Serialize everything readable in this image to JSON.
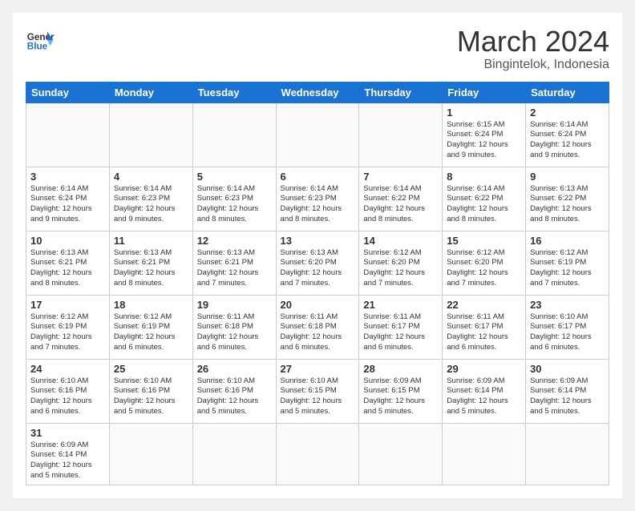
{
  "header": {
    "logo_line1": "General",
    "logo_line2": "Blue",
    "month_title": "March 2024",
    "subtitle": "Bingintelok, Indonesia"
  },
  "days_of_week": [
    "Sunday",
    "Monday",
    "Tuesday",
    "Wednesday",
    "Thursday",
    "Friday",
    "Saturday"
  ],
  "weeks": [
    [
      null,
      null,
      null,
      null,
      null,
      {
        "day": "1",
        "sunrise": "Sunrise: 6:15 AM",
        "sunset": "Sunset: 6:24 PM",
        "daylight": "Daylight: 12 hours and 9 minutes."
      },
      {
        "day": "2",
        "sunrise": "Sunrise: 6:14 AM",
        "sunset": "Sunset: 6:24 PM",
        "daylight": "Daylight: 12 hours and 9 minutes."
      }
    ],
    [
      {
        "day": "3",
        "sunrise": "Sunrise: 6:14 AM",
        "sunset": "Sunset: 6:24 PM",
        "daylight": "Daylight: 12 hours and 9 minutes."
      },
      {
        "day": "4",
        "sunrise": "Sunrise: 6:14 AM",
        "sunset": "Sunset: 6:23 PM",
        "daylight": "Daylight: 12 hours and 9 minutes."
      },
      {
        "day": "5",
        "sunrise": "Sunrise: 6:14 AM",
        "sunset": "Sunset: 6:23 PM",
        "daylight": "Daylight: 12 hours and 8 minutes."
      },
      {
        "day": "6",
        "sunrise": "Sunrise: 6:14 AM",
        "sunset": "Sunset: 6:23 PM",
        "daylight": "Daylight: 12 hours and 8 minutes."
      },
      {
        "day": "7",
        "sunrise": "Sunrise: 6:14 AM",
        "sunset": "Sunset: 6:22 PM",
        "daylight": "Daylight: 12 hours and 8 minutes."
      },
      {
        "day": "8",
        "sunrise": "Sunrise: 6:14 AM",
        "sunset": "Sunset: 6:22 PM",
        "daylight": "Daylight: 12 hours and 8 minutes."
      },
      {
        "day": "9",
        "sunrise": "Sunrise: 6:13 AM",
        "sunset": "Sunset: 6:22 PM",
        "daylight": "Daylight: 12 hours and 8 minutes."
      }
    ],
    [
      {
        "day": "10",
        "sunrise": "Sunrise: 6:13 AM",
        "sunset": "Sunset: 6:21 PM",
        "daylight": "Daylight: 12 hours and 8 minutes."
      },
      {
        "day": "11",
        "sunrise": "Sunrise: 6:13 AM",
        "sunset": "Sunset: 6:21 PM",
        "daylight": "Daylight: 12 hours and 8 minutes."
      },
      {
        "day": "12",
        "sunrise": "Sunrise: 6:13 AM",
        "sunset": "Sunset: 6:21 PM",
        "daylight": "Daylight: 12 hours and 7 minutes."
      },
      {
        "day": "13",
        "sunrise": "Sunrise: 6:13 AM",
        "sunset": "Sunset: 6:20 PM",
        "daylight": "Daylight: 12 hours and 7 minutes."
      },
      {
        "day": "14",
        "sunrise": "Sunrise: 6:12 AM",
        "sunset": "Sunset: 6:20 PM",
        "daylight": "Daylight: 12 hours and 7 minutes."
      },
      {
        "day": "15",
        "sunrise": "Sunrise: 6:12 AM",
        "sunset": "Sunset: 6:20 PM",
        "daylight": "Daylight: 12 hours and 7 minutes."
      },
      {
        "day": "16",
        "sunrise": "Sunrise: 6:12 AM",
        "sunset": "Sunset: 6:19 PM",
        "daylight": "Daylight: 12 hours and 7 minutes."
      }
    ],
    [
      {
        "day": "17",
        "sunrise": "Sunrise: 6:12 AM",
        "sunset": "Sunset: 6:19 PM",
        "daylight": "Daylight: 12 hours and 7 minutes."
      },
      {
        "day": "18",
        "sunrise": "Sunrise: 6:12 AM",
        "sunset": "Sunset: 6:19 PM",
        "daylight": "Daylight: 12 hours and 6 minutes."
      },
      {
        "day": "19",
        "sunrise": "Sunrise: 6:11 AM",
        "sunset": "Sunset: 6:18 PM",
        "daylight": "Daylight: 12 hours and 6 minutes."
      },
      {
        "day": "20",
        "sunrise": "Sunrise: 6:11 AM",
        "sunset": "Sunset: 6:18 PM",
        "daylight": "Daylight: 12 hours and 6 minutes."
      },
      {
        "day": "21",
        "sunrise": "Sunrise: 6:11 AM",
        "sunset": "Sunset: 6:17 PM",
        "daylight": "Daylight: 12 hours and 6 minutes."
      },
      {
        "day": "22",
        "sunrise": "Sunrise: 6:11 AM",
        "sunset": "Sunset: 6:17 PM",
        "daylight": "Daylight: 12 hours and 6 minutes."
      },
      {
        "day": "23",
        "sunrise": "Sunrise: 6:10 AM",
        "sunset": "Sunset: 6:17 PM",
        "daylight": "Daylight: 12 hours and 6 minutes."
      }
    ],
    [
      {
        "day": "24",
        "sunrise": "Sunrise: 6:10 AM",
        "sunset": "Sunset: 6:16 PM",
        "daylight": "Daylight: 12 hours and 6 minutes."
      },
      {
        "day": "25",
        "sunrise": "Sunrise: 6:10 AM",
        "sunset": "Sunset: 6:16 PM",
        "daylight": "Daylight: 12 hours and 5 minutes."
      },
      {
        "day": "26",
        "sunrise": "Sunrise: 6:10 AM",
        "sunset": "Sunset: 6:16 PM",
        "daylight": "Daylight: 12 hours and 5 minutes."
      },
      {
        "day": "27",
        "sunrise": "Sunrise: 6:10 AM",
        "sunset": "Sunset: 6:15 PM",
        "daylight": "Daylight: 12 hours and 5 minutes."
      },
      {
        "day": "28",
        "sunrise": "Sunrise: 6:09 AM",
        "sunset": "Sunset: 6:15 PM",
        "daylight": "Daylight: 12 hours and 5 minutes."
      },
      {
        "day": "29",
        "sunrise": "Sunrise: 6:09 AM",
        "sunset": "Sunset: 6:14 PM",
        "daylight": "Daylight: 12 hours and 5 minutes."
      },
      {
        "day": "30",
        "sunrise": "Sunrise: 6:09 AM",
        "sunset": "Sunset: 6:14 PM",
        "daylight": "Daylight: 12 hours and 5 minutes."
      }
    ],
    [
      {
        "day": "31",
        "sunrise": "Sunrise: 6:09 AM",
        "sunset": "Sunset: 6:14 PM",
        "daylight": "Daylight: 12 hours and 5 minutes."
      },
      null,
      null,
      null,
      null,
      null,
      null
    ]
  ]
}
